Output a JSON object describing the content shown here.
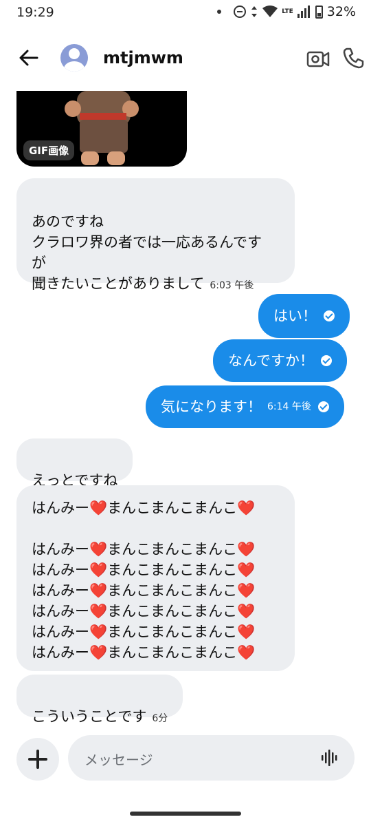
{
  "status_bar": {
    "time": "19:29",
    "network": "LTE",
    "battery": "32%"
  },
  "header": {
    "contact_name": "mtjmwm"
  },
  "gif": {
    "label": "GIF画像"
  },
  "messages": [
    {
      "side": "received",
      "text": "あのですね\nクラロワ界の者では一応あるんです\nが\n聞きたいことがありまして",
      "time": "6:03 午後"
    },
    {
      "side": "sent",
      "text": "はい！"
    },
    {
      "side": "sent",
      "text": "なんですか！"
    },
    {
      "side": "sent",
      "text": "気になります！",
      "time": "6:14 午後"
    },
    {
      "side": "received",
      "text": "えっとですね"
    },
    {
      "side": "received",
      "lines": [
        {
          "text": "はんみー",
          "after": "まんこまんこまんこ"
        },
        {
          "text": "",
          "after": ""
        },
        {
          "text": "はんみー",
          "after": "まんこまんこまんこ"
        },
        {
          "text": "はんみー",
          "after": "まんこまんこまんこ"
        },
        {
          "text": "はんみー",
          "after": "まんこまんこまんこ"
        },
        {
          "text": "はんみー",
          "after": "まんこまんこまんこ"
        },
        {
          "text": "はんみー",
          "after": "まんこまんこまんこ"
        },
        {
          "text": "はんみー",
          "after": "まんこまんこまんこ"
        }
      ]
    },
    {
      "side": "received",
      "text": "こういうことです",
      "time": "6分"
    }
  ],
  "heart_glyph": "❤️",
  "composer": {
    "placeholder": "メッセージ"
  },
  "colors": {
    "accent": "#1a8ce9",
    "received_bubble": "#eceef1",
    "heart": "#e0202f"
  },
  "icons": [
    "back-arrow-icon",
    "avatar",
    "video-call-icon",
    "phone-icon",
    "plus-icon",
    "voice-icon",
    "check-icon"
  ]
}
